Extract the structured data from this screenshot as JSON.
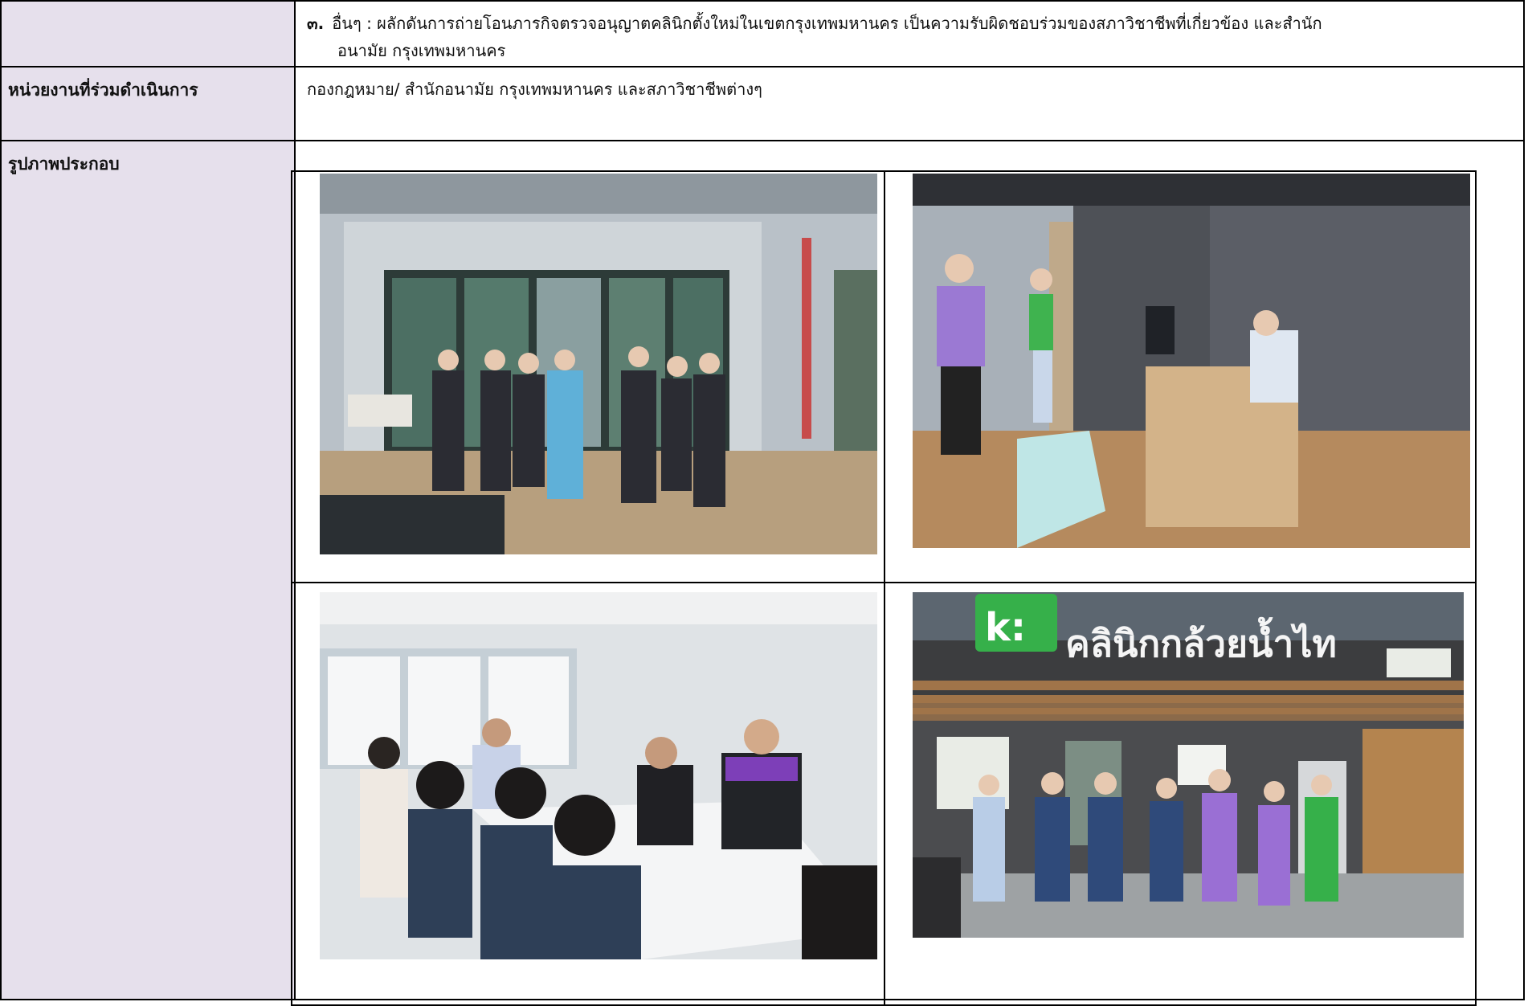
{
  "row1": {
    "item_number": "๓.",
    "item_text_line1": "อื่นๆ : ผลักดันการถ่ายโอนภารกิจตรวจอนุญาตคลินิกตั้งใหม่ในเขตกรุงเทพมหานคร เป็นความรับผิดชอบร่วมของสภาวิชาชีพที่เกี่ยวข้อง และสำนัก",
    "item_text_line2": "อนามัย กรุงเทพมหานคร"
  },
  "row2": {
    "label": "หน่วยงานที่ร่วมดำเนินการ",
    "value": "กองกฎหมาย/ สำนักอนามัย กรุงเทพมหานคร และสภาวิชาชีพต่างๆ"
  },
  "row3": {
    "label": "รูปภาพประกอบ"
  },
  "photos": {
    "photo4_sign": "คลินิกกล้วยน้ำไท",
    "photo4_logo": "k:"
  },
  "colors": {
    "label_bg": "#e6e0ec",
    "border": "#000000"
  }
}
